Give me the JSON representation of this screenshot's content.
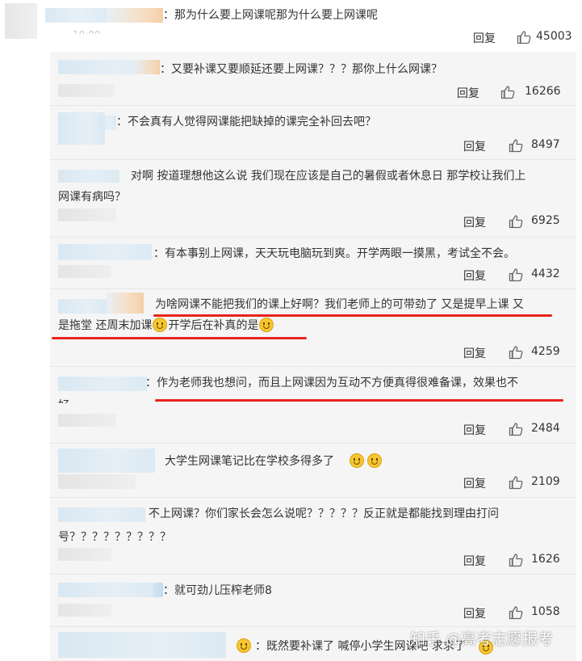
{
  "top_comment": {
    "text": "：那为什么要上网课呢那为什么要上网课呢",
    "time_partial": "10:00",
    "reply_label": "回复",
    "likes": "45003"
  },
  "replies": [
    {
      "text": "：又要补课又要顺延还要上网课？？？那你上什么网课？",
      "reply_label": "回复",
      "likes": "16266"
    },
    {
      "text": "：不会真有人觉得网课能把缺掉的课完全补回去吧？",
      "reply_label": "回复",
      "likes": "8497"
    },
    {
      "text_line1": "对啊 按道理想他这么说 我们现在应该是自己的暑假或者休息日 那学校让我们上",
      "text_line2": "网课有病吗？",
      "reply_label": "回复",
      "likes": "6925"
    },
    {
      "text": "：有本事别上网课，天天玩电脑玩到爽。开学两眼一摸黑，考试全不会。",
      "reply_label": "回复",
      "likes": "4432"
    },
    {
      "text_line1": "为啥网课不能把我们的课上好啊？我们老师上的可带劲了 又是提早上课 又",
      "text_line2a": "是拖堂 还周末加课",
      "text_line2b": "开学后在补真的是",
      "reply_label": "回复",
      "likes": "4259"
    },
    {
      "text_line1": "：作为老师我也想问，而且上网课因为互动不方便真得很难备课，效果也不",
      "text_line2": "好",
      "reply_label": "回复",
      "likes": "2484"
    },
    {
      "text": "大学生网课笔记比在学校多得多了",
      "reply_label": "回复",
      "likes": "2109"
    },
    {
      "text_line1": "不上网课？你们家长会怎么说呢？？？？？反正就是都能找到理由打问",
      "text_line2": "号？？？？？？？？？",
      "reply_label": "回复",
      "likes": "1626"
    },
    {
      "text": "：就可劲儿压榨老师8",
      "reply_label": "回复",
      "likes": "1058"
    },
    {
      "text": "：既然要补课了 喊停小学生网课吧 求求了"
    }
  ],
  "watermark": "知乎 @高考志愿报考",
  "colors": {
    "underline": "#e8231c",
    "background": "#f5f5f5"
  },
  "icons": {
    "like": "thumbs-up-icon",
    "emoji": "smile-emoji-icon"
  }
}
